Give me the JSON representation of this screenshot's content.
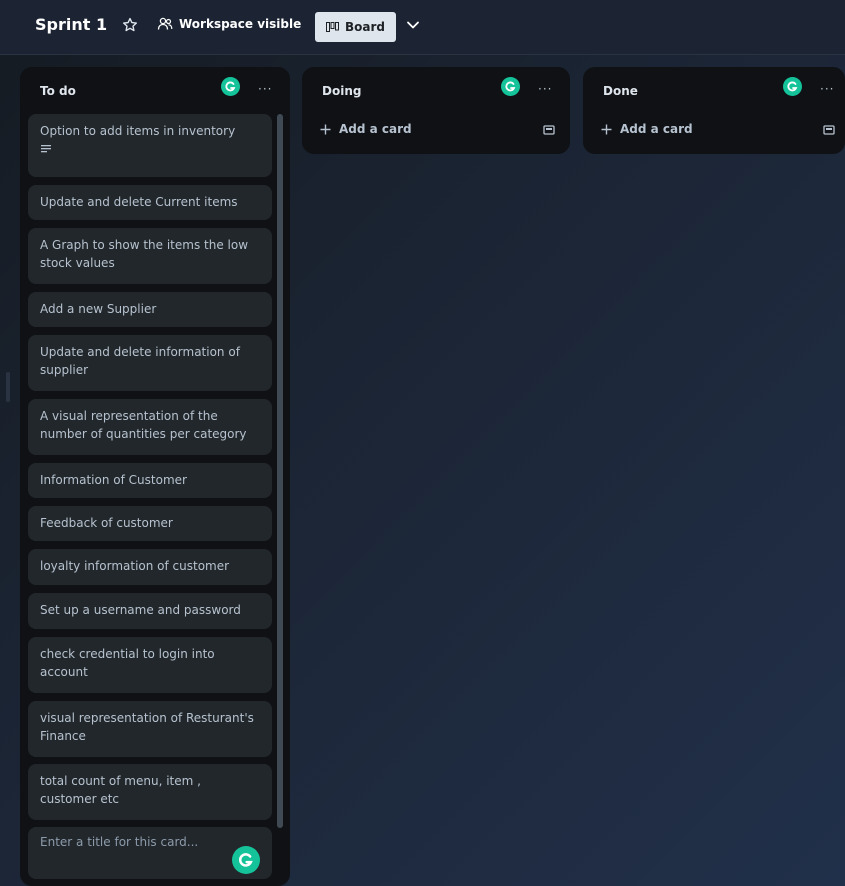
{
  "header": {
    "board_title": "Sprint 1",
    "workspace_label": "Workspace visible",
    "board_view_label": "Board"
  },
  "lists": [
    {
      "title": "To do",
      "cards": [
        {
          "text": "Option to add items in inventory",
          "has_description": true
        },
        {
          "text": "Update and delete Current items"
        },
        {
          "text": "A Graph to show the items the low stock values"
        },
        {
          "text": "Add a new Supplier"
        },
        {
          "text": "Update and delete information of supplier"
        },
        {
          "text": "A visual representation of the number of quantities per category"
        },
        {
          "text": "Information of Customer"
        },
        {
          "text": "Feedback of customer"
        },
        {
          "text": "loyalty information of customer"
        },
        {
          "text": "Set up a username and password"
        },
        {
          "text": "check credential to login into account"
        },
        {
          "text": "visual representation of Resturant's Finance"
        },
        {
          "text": "total count of menu, item , customer etc"
        }
      ],
      "composer_placeholder": "Enter a title for this card..."
    },
    {
      "title": "Doing",
      "add_card_label": "Add a card"
    },
    {
      "title": "Done",
      "add_card_label": "Add a card"
    }
  ],
  "colors": {
    "list_bg": "#0f1114",
    "card_bg": "#22272b",
    "grammarly_green": "#15c39a",
    "board_button_bg": "#dfe5ec"
  },
  "icons": {
    "star": "star-icon",
    "workspace": "people-icon",
    "board": "board-icon",
    "chevron": "chevron-down-icon",
    "list_menu": "ellipsis-icon",
    "grammarly": "grammarly-icon",
    "description": "description-icon",
    "template": "card-template-icon",
    "add": "plus-icon"
  }
}
